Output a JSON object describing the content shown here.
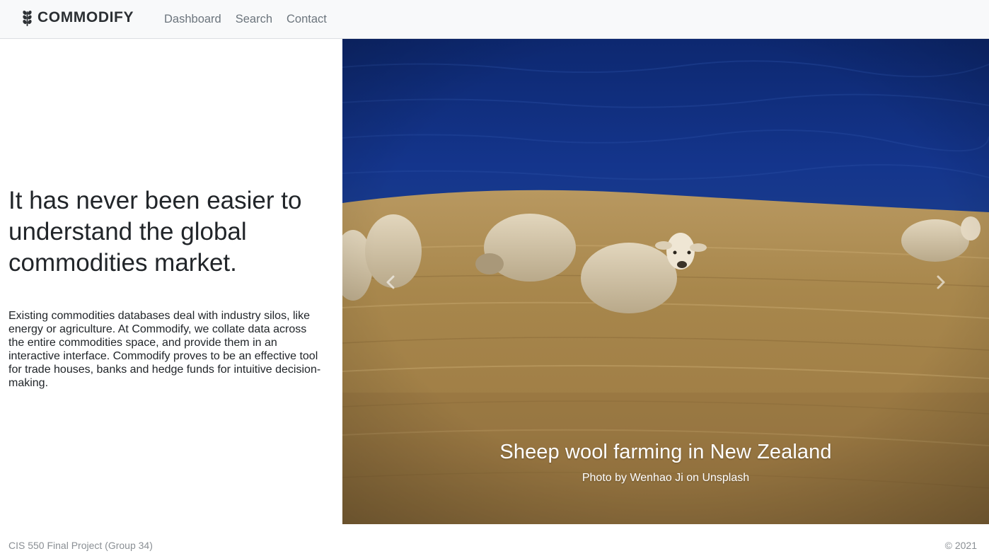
{
  "navbar": {
    "brand": "COMMODIFY",
    "links": [
      "Dashboard",
      "Search",
      "Contact"
    ]
  },
  "hero": {
    "headline": "It has never been easier to understand the global commodities market.",
    "description": "Existing commodities databases deal with industry silos, like energy or agriculture. At Commodify, we collate data across the entire commodities space, and provide them in an interactive interface. Commodify proves to be an effective tool for trade houses, banks and hedge funds for intuitive decision-making."
  },
  "carousel": {
    "caption_title": "Sheep wool farming in New Zealand",
    "caption_credit": "Photo by Wenhao Ji on Unsplash"
  },
  "footer": {
    "left": "CIS 550 Final Project (Group 34)",
    "right": "© 2021"
  },
  "colors": {
    "navbar_bg": "#f8f9fa",
    "nav_link": "#6c757d",
    "text": "#212529",
    "footer_text": "#8a8f94"
  }
}
